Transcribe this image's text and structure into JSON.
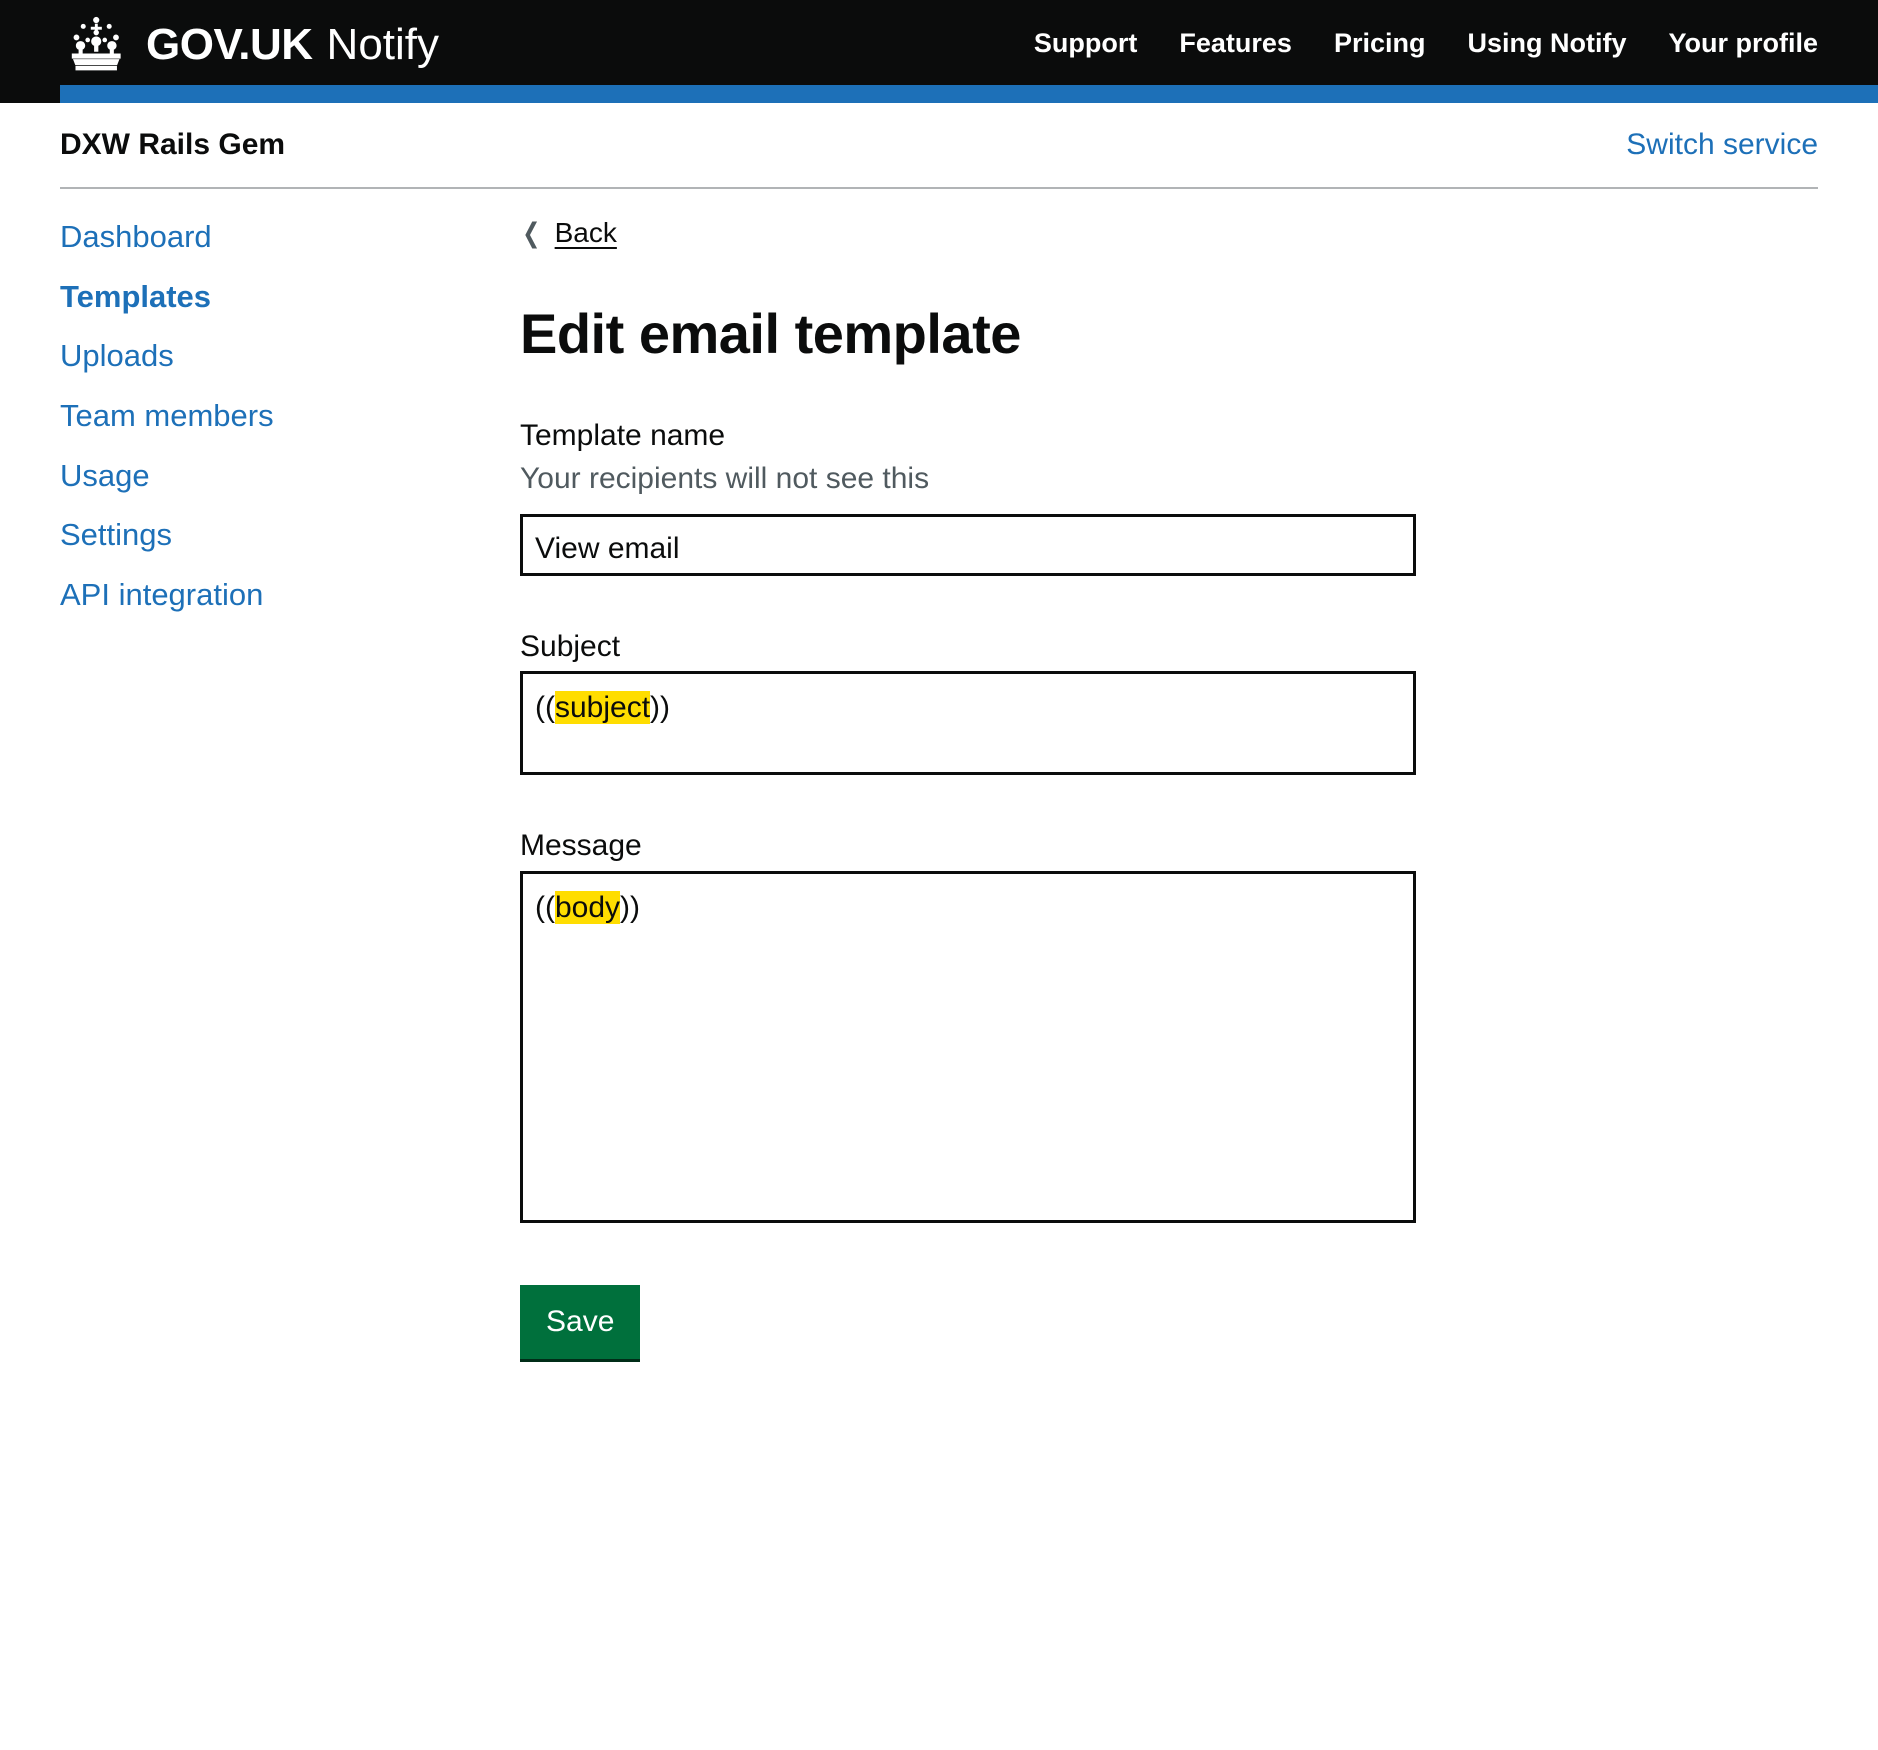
{
  "header": {
    "brand_govuk": "GOV.UK",
    "brand_product": "Notify",
    "nav": [
      {
        "label": "Support"
      },
      {
        "label": "Features"
      },
      {
        "label": "Pricing"
      },
      {
        "label": "Using Notify"
      },
      {
        "label": "Your profile"
      }
    ]
  },
  "service_bar": {
    "service_name": "DXW Rails Gem",
    "switch_service": "Switch service"
  },
  "sidebar": {
    "items": [
      {
        "label": "Dashboard",
        "active": false
      },
      {
        "label": "Templates",
        "active": true
      },
      {
        "label": "Uploads",
        "active": false
      },
      {
        "label": "Team members",
        "active": false
      },
      {
        "label": "Usage",
        "active": false
      },
      {
        "label": "Settings",
        "active": false
      },
      {
        "label": "API integration",
        "active": false
      }
    ]
  },
  "main": {
    "back_link": "Back",
    "title": "Edit email template",
    "template_name": {
      "label": "Template name",
      "hint": "Your recipients will not see this",
      "value": "View email"
    },
    "subject": {
      "label": "Subject",
      "prefix": "((",
      "placeholder_name": "subject",
      "suffix": "))"
    },
    "message": {
      "label": "Message",
      "prefix": "((",
      "placeholder_name": "body",
      "suffix": "))"
    },
    "save_label": "Save"
  },
  "colors": {
    "header_black": "#0b0c0c",
    "accent_blue": "#1d70b8",
    "link_blue": "#1d70b8",
    "highlight_yellow": "#ffdd00",
    "button_green": "#00703c",
    "hint_grey": "#505a5f"
  }
}
